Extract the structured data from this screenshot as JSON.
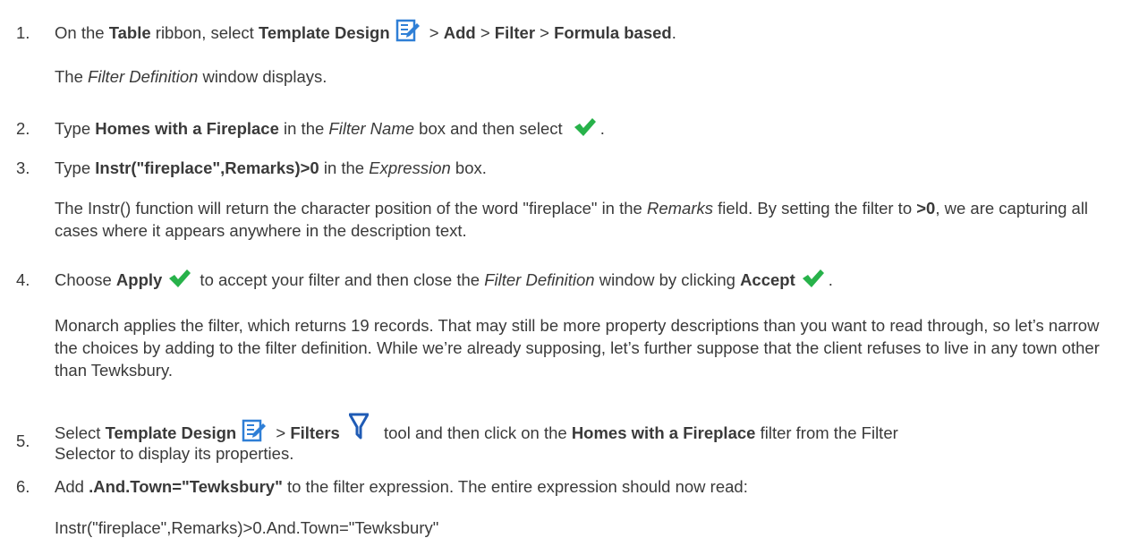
{
  "steps": [
    {
      "number": "1.",
      "parts": [
        {
          "text": "On the ",
          "style": "normal"
        },
        {
          "text": "Table",
          "style": "bold"
        },
        {
          "text": " ribbon, select ",
          "style": "normal"
        },
        {
          "text": "Template Design",
          "style": "bold"
        },
        {
          "icon": "template-design-icon"
        },
        {
          "text": " > ",
          "style": "normal"
        },
        {
          "text": "Add",
          "style": "bold"
        },
        {
          "text": " > ",
          "style": "normal"
        },
        {
          "text": "Filter",
          "style": "bold"
        },
        {
          "text": " > ",
          "style": "normal"
        },
        {
          "text": "Formula based",
          "style": "bold"
        },
        {
          "text": ".",
          "style": "normal"
        }
      ],
      "followups": [
        [
          {
            "text": "The ",
            "style": "normal"
          },
          {
            "text": "Filter Definition",
            "style": "italic"
          },
          {
            "text": " window displays.",
            "style": "normal"
          }
        ]
      ]
    },
    {
      "number": "2.",
      "parts": [
        {
          "text": "Type ",
          "style": "normal"
        },
        {
          "text": "Homes with a Fireplace",
          "style": "bold"
        },
        {
          "text": " in the ",
          "style": "normal"
        },
        {
          "text": "Filter Name",
          "style": "italic"
        },
        {
          "text": " box and then select ",
          "style": "normal"
        },
        {
          "icon": "checkmark-icon"
        },
        {
          "text": ".",
          "style": "normal"
        }
      ],
      "followups": []
    },
    {
      "number": "3.",
      "parts": [
        {
          "text": "Type ",
          "style": "normal"
        },
        {
          "text": "Instr(\"fireplace\",Remarks)>0",
          "style": "bold"
        },
        {
          "text": " in the ",
          "style": "normal"
        },
        {
          "text": "Expression",
          "style": "italic"
        },
        {
          "text": " box.",
          "style": "normal"
        }
      ],
      "followups": [
        [
          {
            "text": "The Instr() function will return the character position of the word \"fireplace\" in the ",
            "style": "normal"
          },
          {
            "text": "Remarks",
            "style": "italic"
          },
          {
            "text": " field. By setting the filter to ",
            "style": "normal"
          },
          {
            "text": ">0",
            "style": "bold"
          },
          {
            "text": ", we are capturing all cases where it appears anywhere in the description text.",
            "style": "normal"
          }
        ]
      ]
    },
    {
      "number": "4.",
      "parts": [
        {
          "text": "Choose ",
          "style": "normal"
        },
        {
          "text": "Apply",
          "style": "bold"
        },
        {
          "icon": "checkmark-icon"
        },
        {
          "text": " to accept your filter and then close the ",
          "style": "normal"
        },
        {
          "text": "Filter Definition",
          "style": "italic"
        },
        {
          "text": " window by clicking ",
          "style": "normal"
        },
        {
          "text": "Accept",
          "style": "bold"
        },
        {
          "icon": "checkmark-icon"
        },
        {
          "text": ".",
          "style": "normal"
        }
      ],
      "followups": [
        [
          {
            "text": "Monarch applies the filter, which returns 19 records. That may still be more property descriptions than you want to read through, so let’s narrow the choices by adding to the filter definition. While we’re already supposing, let’s further suppose that the client refuses to live in any town other than Tewksbury.",
            "style": "normal"
          }
        ]
      ]
    },
    {
      "number": "5.",
      "parts": [
        {
          "text": "Select ",
          "style": "normal"
        },
        {
          "text": "Template Design",
          "style": "bold"
        },
        {
          "icon": "template-design-icon"
        },
        {
          "text": " > ",
          "style": "normal"
        },
        {
          "text": "Filters",
          "style": "bold"
        },
        {
          "icon": "filter-funnel-icon"
        },
        {
          "text": " tool and then click on the ",
          "style": "normal"
        },
        {
          "text": "Homes with a Fireplace",
          "style": "bold"
        },
        {
          "text": " filter from the Filter Selector to display its properties.",
          "style": "normal"
        }
      ],
      "followups": []
    },
    {
      "number": "6.",
      "parts": [
        {
          "text": "Add ",
          "style": "normal"
        },
        {
          "text": ".And.Town=\"Tewksbury\"",
          "style": "bold"
        },
        {
          "text": " to the filter expression. The entire expression should now read:",
          "style": "normal"
        }
      ],
      "followups": [
        [
          {
            "text": "Instr(\"fireplace\",Remarks)>0.And.Town=\"Tewksbury\"",
            "style": "normal"
          }
        ]
      ]
    }
  ],
  "colors": {
    "text": "#3a3a3a",
    "checkmark": "#27b24a",
    "template_icon": "#2f7fd6",
    "funnel_icon": "#1f5bb5"
  }
}
